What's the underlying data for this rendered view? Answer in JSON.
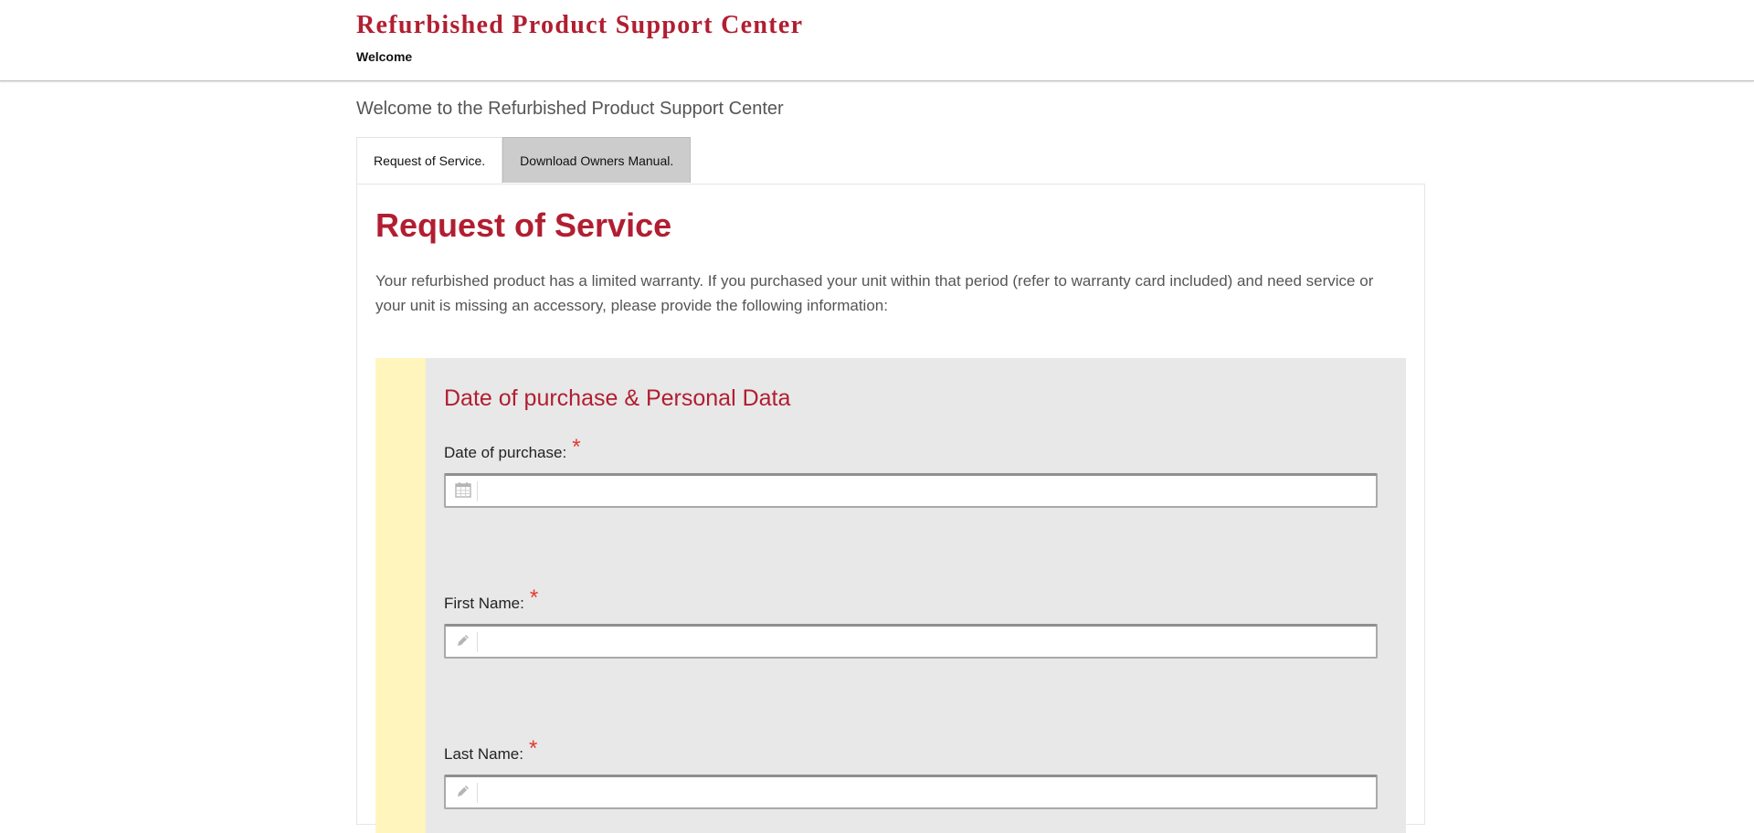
{
  "header": {
    "site_title": "Refurbished Product Support Center",
    "subtitle": "Welcome"
  },
  "welcome_text": "Welcome to the Refurbished Product Support Center",
  "tabs": [
    {
      "label": "Request of Service.",
      "active": true
    },
    {
      "label": "Download Owners Manual.",
      "active": false
    }
  ],
  "main": {
    "title": "Request of Service",
    "intro": "Your refurbished product has a limited warranty. If you purchased your unit within that period (refer to warranty card included) and need service or your unit is missing an accessory, please provide the following information:"
  },
  "form": {
    "section_title": "Date of purchase & Personal Data",
    "required_mark": "*",
    "fields": [
      {
        "label": "Date of purchase:",
        "value": "",
        "icon": "calendar-icon"
      },
      {
        "label": "First Name:",
        "value": "",
        "icon": "pencil-icon"
      },
      {
        "label": "Last Name:",
        "value": "",
        "icon": "pencil-icon"
      }
    ]
  },
  "colors": {
    "brand": "#b11e31",
    "required": "#e03b2f",
    "form_bg": "#e8e8e8",
    "accent_strip": "#fff5bd",
    "inactive_tab": "#cccccc"
  }
}
